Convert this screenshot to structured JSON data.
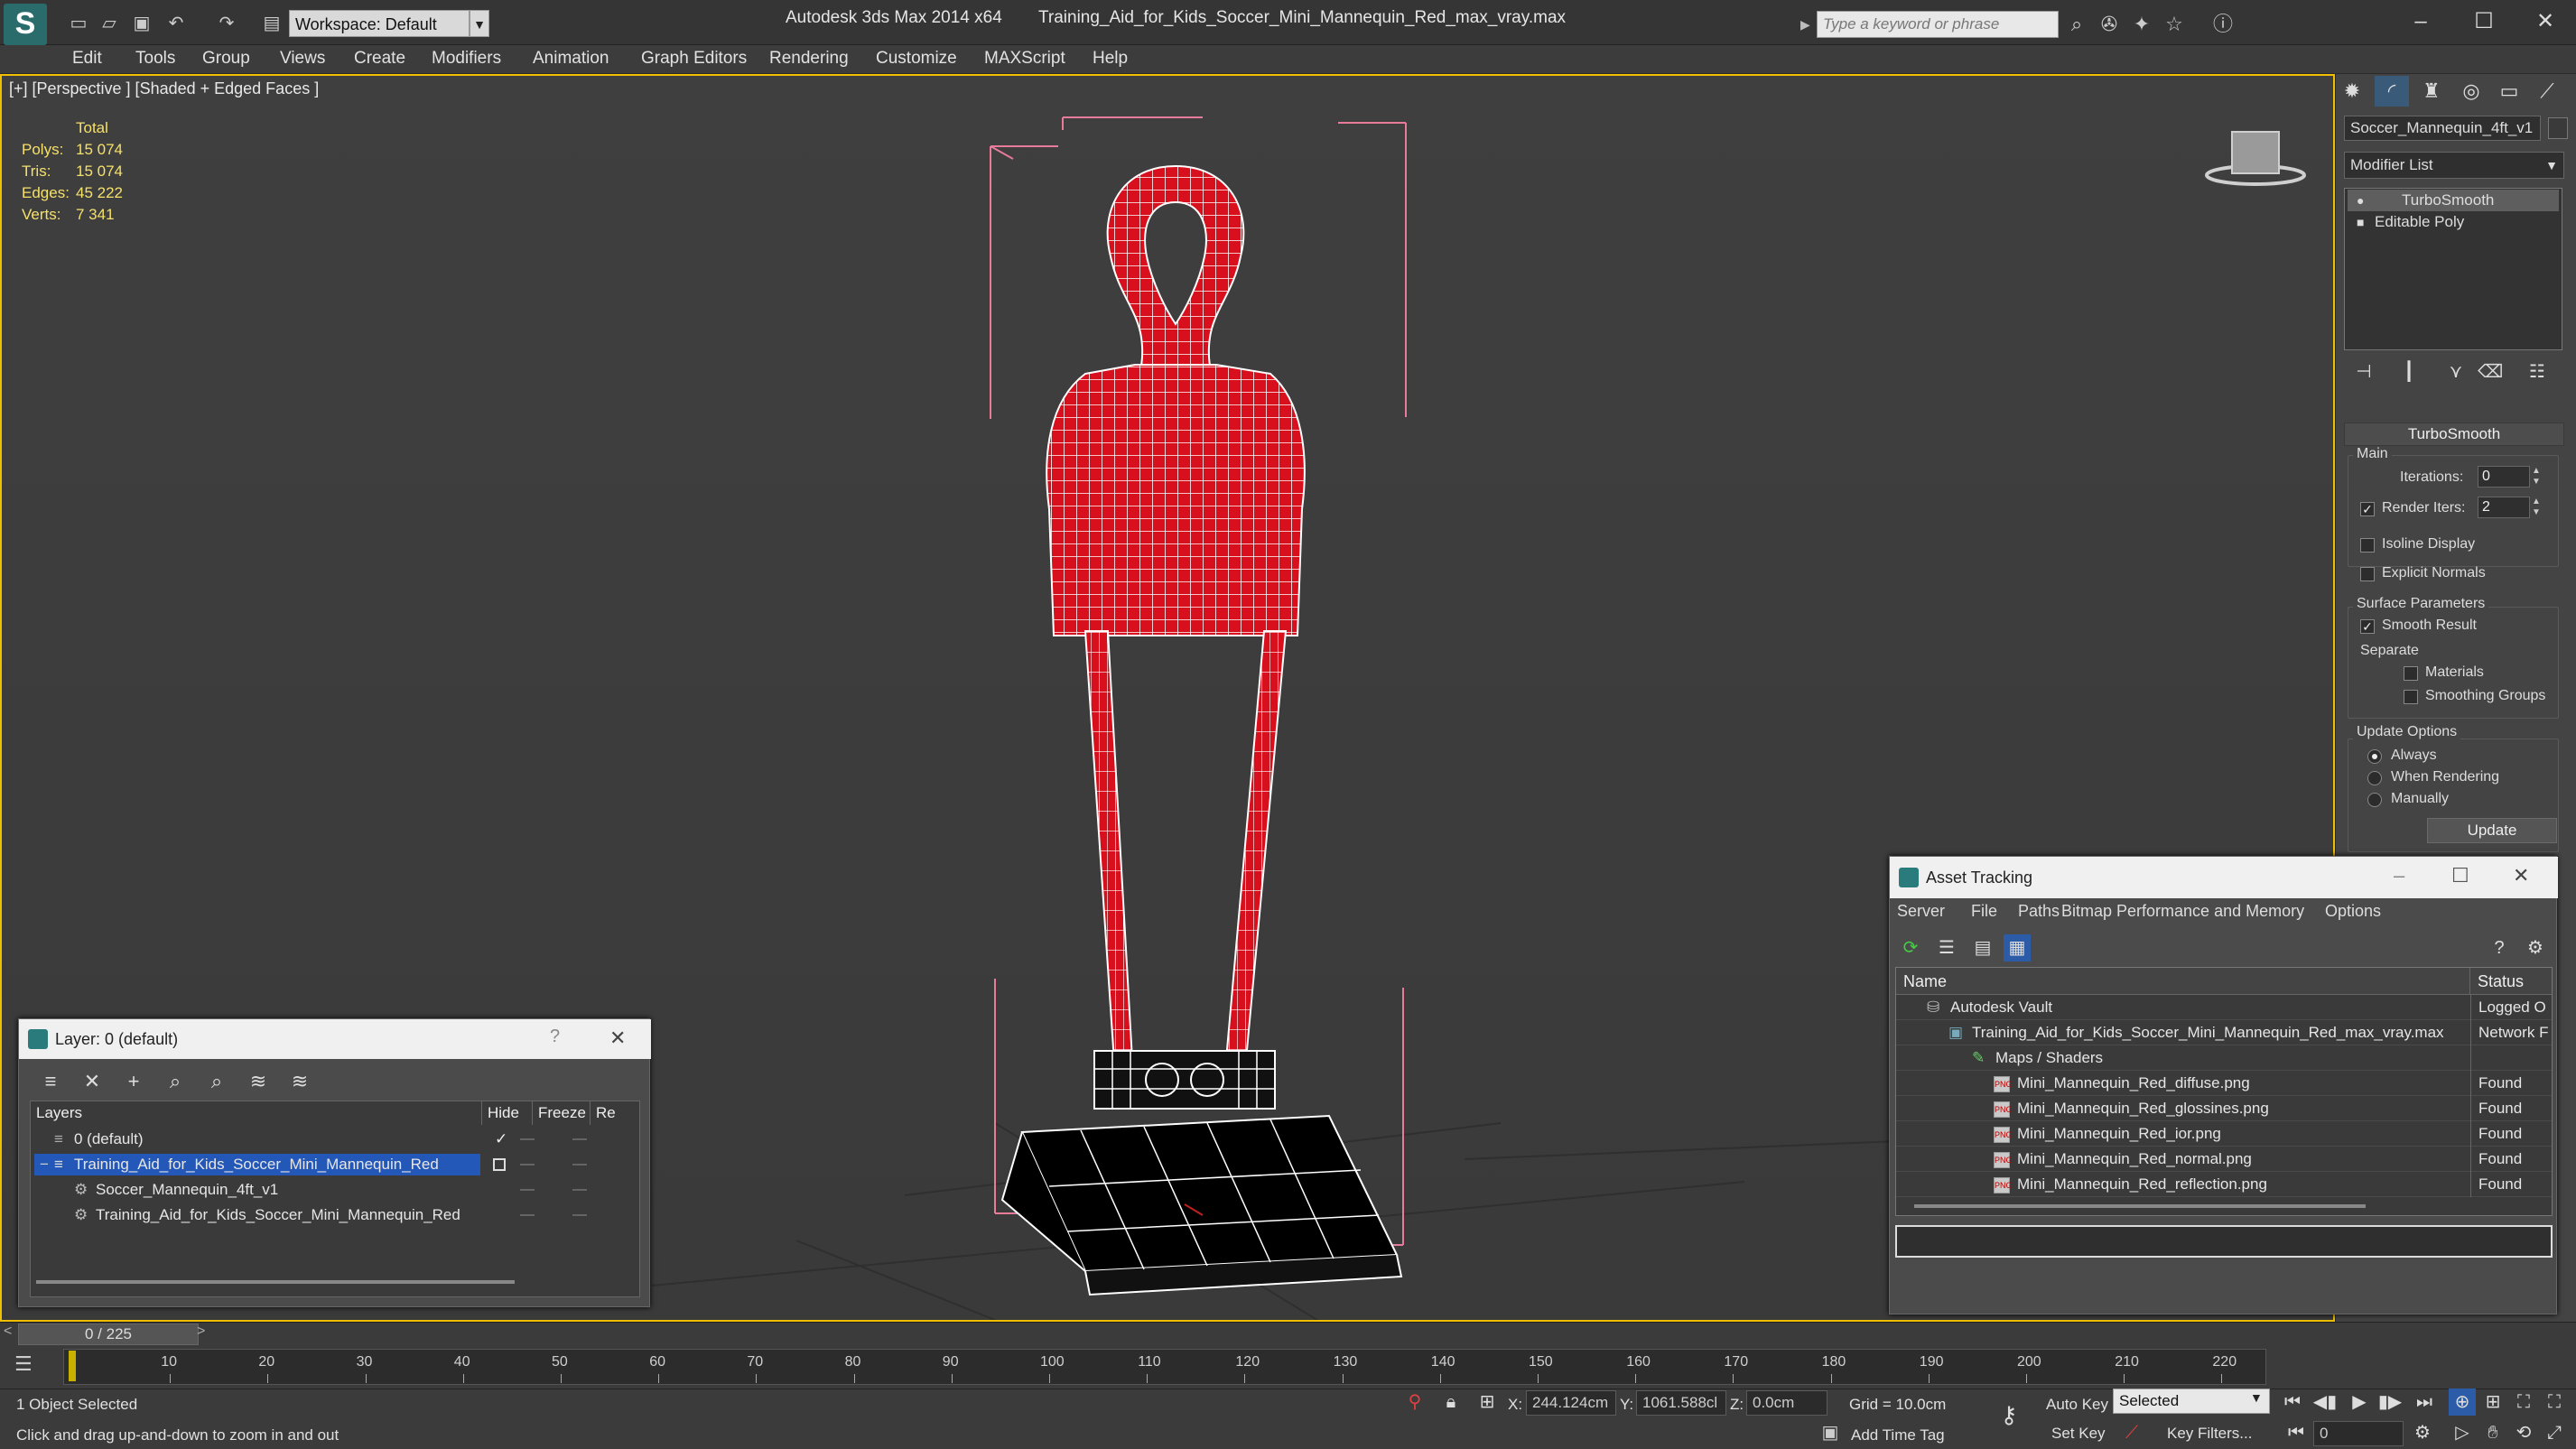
{
  "app": {
    "title": "Autodesk 3ds Max  2014 x64",
    "filename": "Training_Aid_for_Kids_Soccer_Mini_Mannequin_Red_max_vray.max",
    "workspace": "Workspace: Default",
    "search_placeholder": "Type a keyword or phrase"
  },
  "menu": [
    "Edit",
    "Tools",
    "Group",
    "Views",
    "Create",
    "Modifiers",
    "Animation",
    "Graph Editors",
    "Rendering",
    "Customize",
    "MAXScript",
    "Help"
  ],
  "viewport": {
    "label": "[+] [Perspective ] [Shaded + Edged Faces ]",
    "stats": {
      "header": "Total",
      "rows": [
        {
          "label": "Polys:",
          "value": "15 074"
        },
        {
          "label": "Tris:",
          "value": "15 074"
        },
        {
          "label": "Edges:",
          "value": "45 222"
        },
        {
          "label": "Verts:",
          "value": "7 341"
        }
      ]
    },
    "mesh_color": "#e01020",
    "bbox_color": "#e87a9a"
  },
  "command_panel": {
    "object_name": "Soccer_Mannequin_4ft_v1",
    "modifier_list": "Modifier List",
    "stack": [
      "TurboSmooth",
      "Editable Poly"
    ],
    "turbosmooth": {
      "title": "TurboSmooth",
      "main": "Main",
      "iterations_label": "Iterations:",
      "iterations": "0",
      "render_iters_label": "Render Iters:",
      "render_iters": "2",
      "isoline": "Isoline Display",
      "explicit": "Explicit Normals",
      "surface": "Surface Parameters",
      "smooth_result": "Smooth Result",
      "separate": "Separate",
      "materials": "Materials",
      "smoothing_groups": "Smoothing Groups",
      "update_options": "Update Options",
      "always": "Always",
      "when_rendering": "When Rendering",
      "manually": "Manually",
      "update": "Update"
    }
  },
  "layer_dialog": {
    "title": "Layer: 0 (default)",
    "help": "?",
    "close": "✕",
    "columns": [
      "Layers",
      "Hide",
      "Freeze",
      "Re"
    ],
    "rows": [
      {
        "name": "0 (default)"
      },
      {
        "name": "Training_Aid_for_Kids_Soccer_Mini_Mannequin_Red"
      },
      {
        "name": "Soccer_Mannequin_4ft_v1"
      },
      {
        "name": "Training_Aid_for_Kids_Soccer_Mini_Mannequin_Red"
      }
    ]
  },
  "asset_tracking": {
    "title": "Asset Tracking",
    "menu": [
      "Server",
      "File",
      "Paths",
      "Bitmap Performance and Memory",
      "Options"
    ],
    "columns": [
      "Name",
      "Status"
    ],
    "rows": [
      {
        "name": "Autodesk Vault",
        "status": "Logged O"
      },
      {
        "name": "Training_Aid_for_Kids_Soccer_Mini_Mannequin_Red_max_vray.max",
        "status": "Network F"
      },
      {
        "name": "Maps / Shaders",
        "status": ""
      },
      {
        "name": "Mini_Mannequin_Red_diffuse.png",
        "status": "Found"
      },
      {
        "name": "Mini_Mannequin_Red_glossines.png",
        "status": "Found"
      },
      {
        "name": "Mini_Mannequin_Red_ior.png",
        "status": "Found"
      },
      {
        "name": "Mini_Mannequin_Red_normal.png",
        "status": "Found"
      },
      {
        "name": "Mini_Mannequin_Red_reflection.png",
        "status": "Found"
      }
    ],
    "png_label": "PNG"
  },
  "timeline": {
    "frame": "0 / 225",
    "ticks": [
      "10",
      "20",
      "30",
      "40",
      "50",
      "60",
      "70",
      "80",
      "90",
      "100",
      "110",
      "120",
      "130",
      "140",
      "150",
      "160",
      "170",
      "180",
      "190",
      "200",
      "210",
      "220"
    ]
  },
  "status": {
    "selected": "1 Object Selected",
    "prompt": "Click and drag up-and-down to zoom in and out",
    "x_label": "X:",
    "x": "244.124cm",
    "y_label": "Y:",
    "y": "1061.588cl",
    "z_label": "Z:",
    "z": "0.0cm",
    "grid": "Grid = 10.0cm",
    "auto_key": "Auto Key",
    "set_key": "Set Key",
    "selection": "Selected",
    "key_filters": "Key Filters...",
    "add_time_tag": "Add Time Tag",
    "frame_field": "0"
  }
}
